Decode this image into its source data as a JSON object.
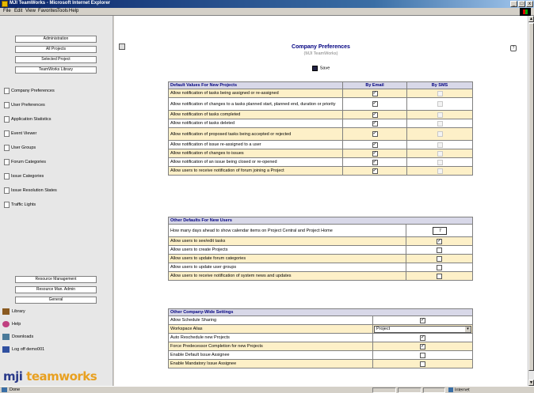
{
  "window": {
    "title": "MJI TeamWorks - Microsoft Internet Explorer",
    "btn_min": "_",
    "btn_max": "□",
    "btn_close": "x"
  },
  "menu": {
    "items": [
      "File",
      "Edit",
      "View",
      "Favorites",
      "Tools",
      "Help"
    ]
  },
  "sidebar": {
    "buttons": [
      "Administration",
      "All Projects",
      "Selected Project",
      "TeamWorks Library"
    ],
    "items": [
      "Company Preferences",
      "User Preferences",
      "Application Statistics",
      "Event Viewer",
      "User Groups",
      "Forum Categories",
      "Issue Categories",
      "Issue Resolution States",
      "Traffic Lights"
    ],
    "lower_buttons": [
      "Resource Management",
      "Resource Man. Admin",
      "General"
    ],
    "nav": [
      {
        "label": "Library",
        "icon": "library-icon",
        "color": "#8a5a20"
      },
      {
        "label": "Help",
        "icon": "help-icon",
        "color": "#c04080"
      },
      {
        "label": "Downloads",
        "icon": "downloads-icon",
        "color": "#4a7a9a"
      },
      {
        "label": "Log off demo001",
        "icon": "logoff-icon",
        "color": "#3050a0"
      }
    ],
    "logo": {
      "mji": "mji",
      "teamworks": "teamworks"
    }
  },
  "main": {
    "title": "Company Preferences",
    "subtitle": "(MJI TeamWorks)",
    "save_label": "Save",
    "help_icon": "?",
    "sections": [
      {
        "header": "Default Values For New Projects",
        "col_email": "By Email",
        "col_sms": "By SMS",
        "rows": [
          {
            "label": "Allow notification of tasks being assigned or re-assigned",
            "email": true,
            "sms": false
          },
          {
            "label": "Allow notification of changes to a tasks planned start, planned end, duration or priority",
            "email": true,
            "sms": false
          },
          {
            "label": "Allow notification of tasks completed",
            "email": true,
            "sms": false
          },
          {
            "label": "Allow notification of tasks deleted",
            "email": true,
            "sms": false
          },
          {
            "label": "Allow notification of proposed tasks being accepted or rejected",
            "email": true,
            "sms": false
          },
          {
            "label": "Allow notification of issue re-assigned to a user",
            "email": true,
            "sms": false
          },
          {
            "label": "Allow notification of changes to issues",
            "email": true,
            "sms": false
          },
          {
            "label": "Allow notification of an issue being closed or re-opened",
            "email": true,
            "sms": false
          },
          {
            "label": "Allow users to receive notification of forum joining a Project",
            "email": true,
            "sms": false
          }
        ]
      },
      {
        "header": "Other Defaults For New Users",
        "rows": [
          {
            "label": "How many days ahead to show calendar items on Project Central and Project Home",
            "value": "7"
          },
          {
            "label": "Allow users to see/edit tasks",
            "checked": true
          },
          {
            "label": "Allow users to create Projects",
            "checked": false
          },
          {
            "label": "Allow users to update forum categories",
            "checked": false
          },
          {
            "label": "Allow users to update user groups",
            "checked": false
          },
          {
            "label": "Allow users to receive notification of system news and updates",
            "checked": false
          }
        ]
      },
      {
        "header": "Other Company-Wide Settings",
        "rows": [
          {
            "label": "Allow Schedule Sharing",
            "checked": true
          },
          {
            "label": "Workspace Alias",
            "value": "Project"
          },
          {
            "label": "Auto Reschedule new Projects",
            "checked": true
          },
          {
            "label": "Force Predecessor Completion for new Projects",
            "checked": true
          },
          {
            "label": "Enable Default Issue Assignee",
            "checked": false
          },
          {
            "label": "Enable Mandatory Issue Assignee",
            "checked": false
          }
        ]
      }
    ]
  },
  "status": {
    "text": "Done",
    "zone": "Internet"
  }
}
